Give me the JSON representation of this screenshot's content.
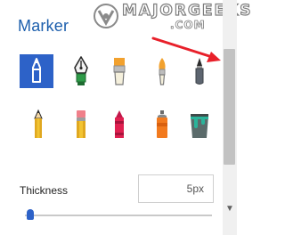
{
  "panel": {
    "title": "Marker"
  },
  "watermark": {
    "brand": "MAJORGEEKS",
    "domain": ".COM"
  },
  "tools": [
    {
      "name": "felt-tip-marker",
      "selected": true
    },
    {
      "name": "fountain-pen"
    },
    {
      "name": "flat-paintbrush"
    },
    {
      "name": "round-paintbrush"
    },
    {
      "name": "calligraphy-marker"
    },
    {
      "name": "pencil"
    },
    {
      "name": "eraser-pencil"
    },
    {
      "name": "crayon"
    },
    {
      "name": "spray-can"
    },
    {
      "name": "paint-bucket"
    }
  ],
  "thickness": {
    "label": "Thickness",
    "value": "5px",
    "slider_fraction": 0.02
  },
  "colors": {
    "accent": "#2d62c8",
    "title": "#1d5fad",
    "annotation_arrow": "#e8202a"
  }
}
